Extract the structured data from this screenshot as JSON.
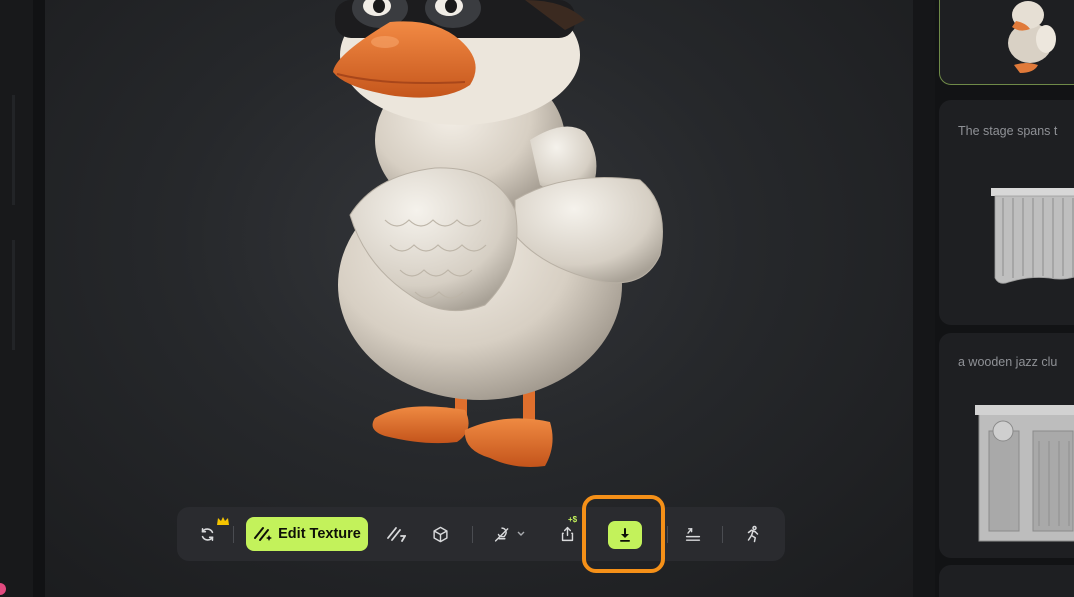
{
  "toolbar": {
    "edit_texture_label": "Edit Texture",
    "cost_badge": "+$",
    "tools": [
      {
        "name": "regenerate",
        "icon": "refresh-icon"
      },
      {
        "name": "edit-texture",
        "icon": "magic-wand-icon"
      },
      {
        "name": "texture-remove",
        "icon": "texture-slash-icon"
      },
      {
        "name": "mesh",
        "icon": "cube-icon"
      },
      {
        "name": "lighting",
        "icon": "bulb-slash-icon"
      },
      {
        "name": "export",
        "icon": "share-icon"
      },
      {
        "name": "download",
        "icon": "download-icon"
      },
      {
        "name": "remesh",
        "icon": "layers-icon"
      },
      {
        "name": "animate",
        "icon": "running-figure-icon"
      }
    ]
  },
  "history": {
    "items": [
      {
        "caption": "",
        "selected": true
      },
      {
        "caption": "The stage spans t",
        "selected": false
      },
      {
        "caption": "a wooden jazz clu",
        "selected": false
      }
    ]
  },
  "colors": {
    "accent": "#c3f25b",
    "highlight": "#f59018",
    "selected_border": "#6f8a48"
  }
}
